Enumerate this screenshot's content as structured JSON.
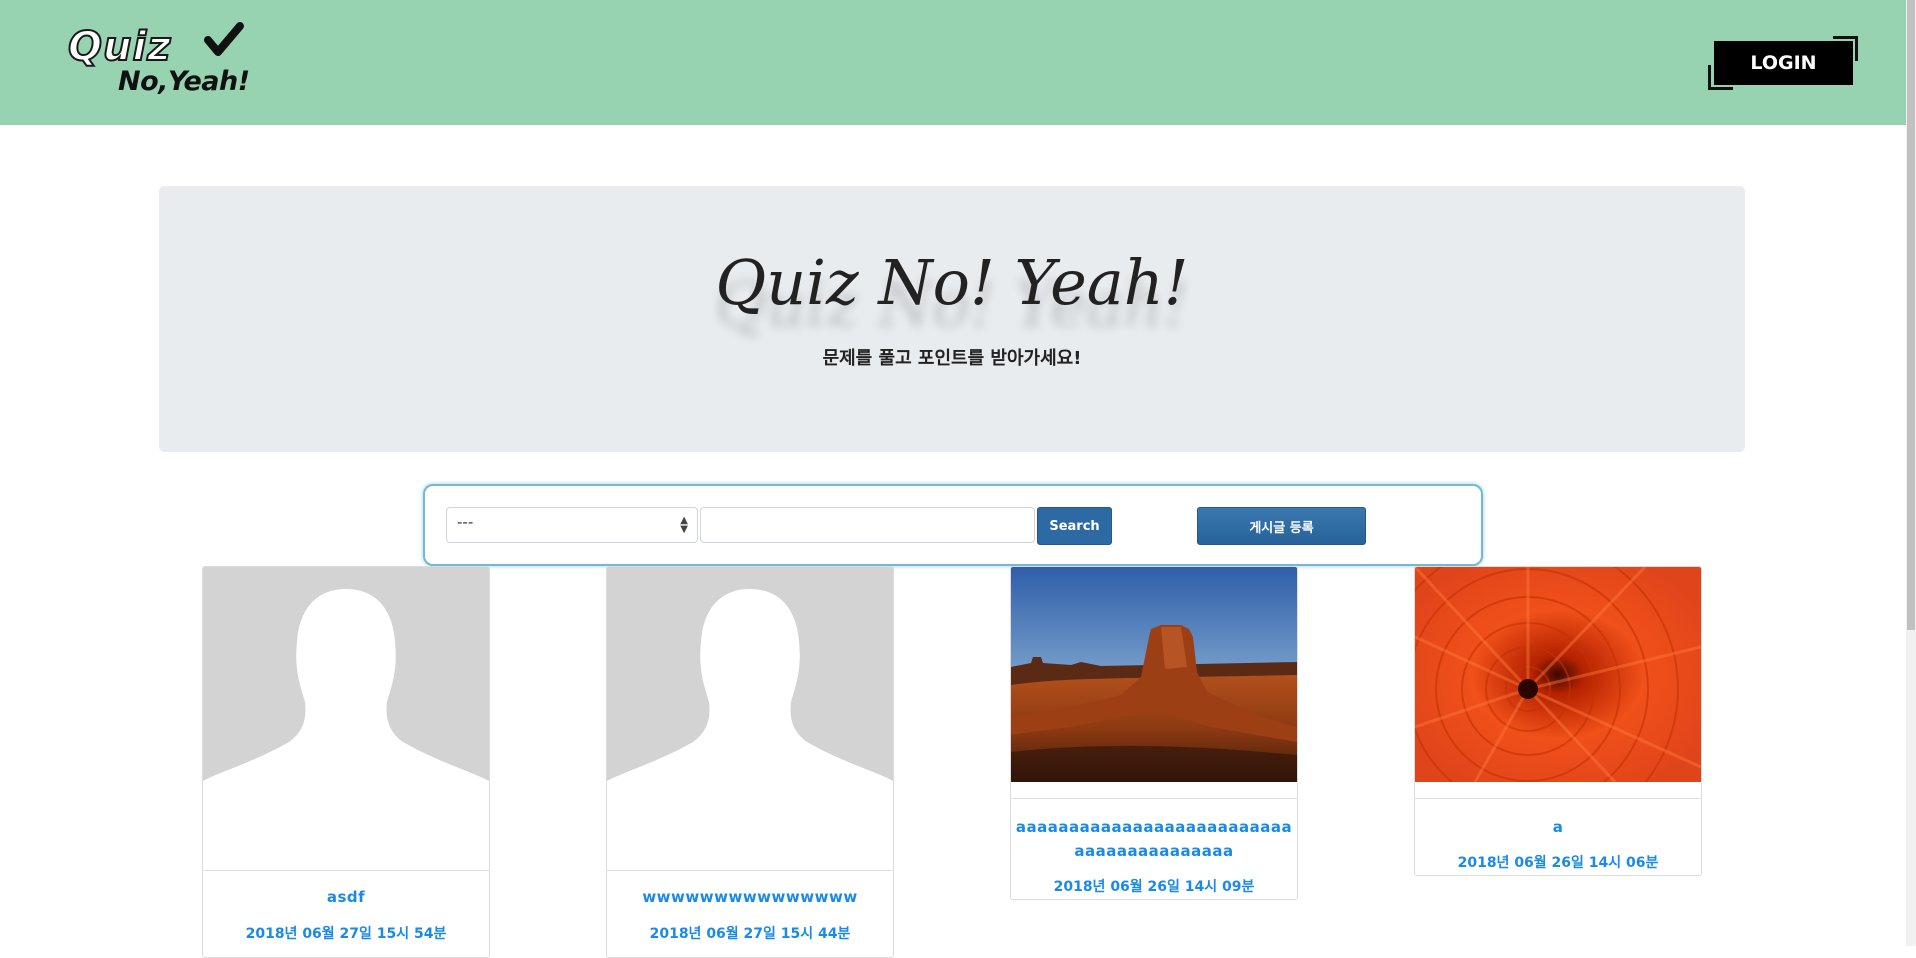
{
  "header": {
    "logo_quiz": "Quiz",
    "logo_sub": "No,Yeah!",
    "login_label": "LOGIN",
    "bg_color": "#98d3b1"
  },
  "jumbotron": {
    "title": "Quiz No! Yeah!",
    "subtitle": "문제를 풀고 포인트를 받아가세요!"
  },
  "search": {
    "select_value": "---",
    "input_value": "",
    "search_label": "Search",
    "post_label": "게시글 등록"
  },
  "cards": [
    {
      "title": "asdf",
      "date": "2018년 06월 27일 15시 54분",
      "image": "default-avatar"
    },
    {
      "title": "wwwwwwwwwwwwwww",
      "date": "2018년 06월 27일 15시 44분",
      "image": "default-avatar"
    },
    {
      "title": "aaaaaaaaaaaaaaaaaaaaaaaaaaaaaaaaaaaaaaaaa",
      "date": "2018년 06월 26일 14시 09분",
      "image": "desert-landscape"
    },
    {
      "title": "a",
      "date": "2018년 06월 26일 14시 06분",
      "image": "orange-chrysanthemum"
    }
  ]
}
